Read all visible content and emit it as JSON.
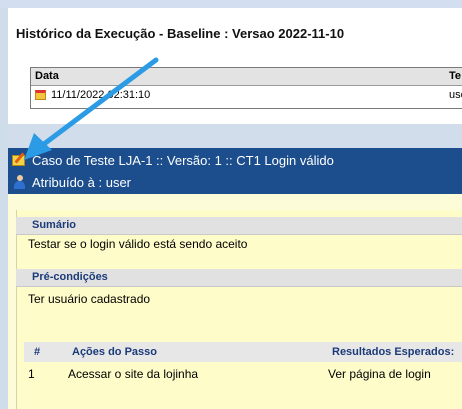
{
  "history": {
    "title": "Histórico da Execução - Baseline : Versao 2022-11-10",
    "table": {
      "headers": [
        "Data",
        "Te"
      ],
      "rows": [
        {
          "date": "11/11/2022 02:31:10",
          "tester": "use"
        }
      ]
    }
  },
  "testcase": {
    "title": "Caso de Teste LJA-1 :: Versão: 1 :: CT1 Login válido",
    "assigned": "Atribuído à : user",
    "summary_label": "Sumário",
    "summary_text": "Testar se o login válido está sendo aceito",
    "preconditions_label": "Pré-condições",
    "preconditions_text": "Ter usuário cadastrado",
    "steps": {
      "headers": [
        "#",
        "Ações do Passo",
        "Resultados Esperados:"
      ],
      "rows": [
        {
          "num": "1",
          "action": "Acessar o site da lojinha",
          "expected": "Ver página de login"
        }
      ]
    }
  },
  "colors": {
    "header_bg": "#1c4e8d",
    "panel_bg": "#fdfcd8",
    "annotation_arrow": "#2b9be6"
  },
  "icons": [
    "calendar-icon",
    "testcase-edit-icon",
    "user-icon",
    "annotation-arrow"
  ]
}
